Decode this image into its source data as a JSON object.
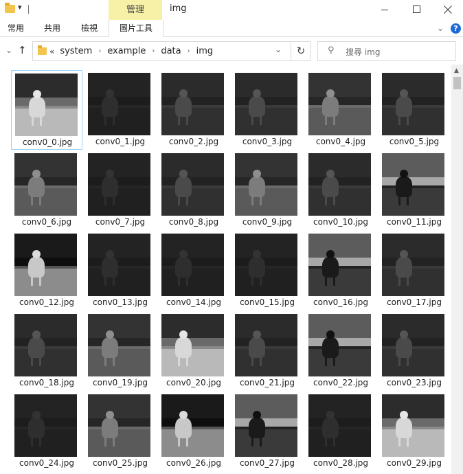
{
  "window": {
    "title": "img",
    "context_tab": "管理"
  },
  "ribbon": {
    "tabs": [
      "常用",
      "共用",
      "檢視",
      "圖片工具"
    ]
  },
  "address": {
    "overflow": "«",
    "crumbs": [
      "system",
      "example",
      "data",
      "img"
    ]
  },
  "search": {
    "placeholder": "搜尋 img"
  },
  "files": [
    {
      "name": "conv0_0.jpg",
      "tone": "bright"
    },
    {
      "name": "conv0_1.jpg",
      "tone": "dark"
    },
    {
      "name": "conv0_2.jpg",
      "tone": "dim"
    },
    {
      "name": "conv0_3.jpg",
      "tone": "dim"
    },
    {
      "name": "conv0_4.jpg",
      "tone": "mid"
    },
    {
      "name": "conv0_5.jpg",
      "tone": "dim"
    },
    {
      "name": "conv0_6.jpg",
      "tone": "mid"
    },
    {
      "name": "conv0_7.jpg",
      "tone": "dark"
    },
    {
      "name": "conv0_8.jpg",
      "tone": "dim"
    },
    {
      "name": "conv0_9.jpg",
      "tone": "mid"
    },
    {
      "name": "conv0_10.jpg",
      "tone": "dim"
    },
    {
      "name": "conv0_11.jpg",
      "tone": "inverted"
    },
    {
      "name": "conv0_12.jpg",
      "tone": "contrast"
    },
    {
      "name": "conv0_13.jpg",
      "tone": "dark"
    },
    {
      "name": "conv0_14.jpg",
      "tone": "dark"
    },
    {
      "name": "conv0_15.jpg",
      "tone": "dark"
    },
    {
      "name": "conv0_16.jpg",
      "tone": "inverted"
    },
    {
      "name": "conv0_17.jpg",
      "tone": "dim"
    },
    {
      "name": "conv0_18.jpg",
      "tone": "dim"
    },
    {
      "name": "conv0_19.jpg",
      "tone": "mid"
    },
    {
      "name": "conv0_20.jpg",
      "tone": "bright"
    },
    {
      "name": "conv0_21.jpg",
      "tone": "dim"
    },
    {
      "name": "conv0_22.jpg",
      "tone": "inverted"
    },
    {
      "name": "conv0_23.jpg",
      "tone": "dim"
    },
    {
      "name": "conv0_24.jpg",
      "tone": "dark"
    },
    {
      "name": "conv0_25.jpg",
      "tone": "mid"
    },
    {
      "name": "conv0_26.jpg",
      "tone": "contrast"
    },
    {
      "name": "conv0_27.jpg",
      "tone": "inverted"
    },
    {
      "name": "conv0_28.jpg",
      "tone": "dark"
    },
    {
      "name": "conv0_29.jpg",
      "tone": "bright"
    }
  ],
  "selected_file": "conv0_0.jpg",
  "colors": {
    "context_tab_bg": "#f7f1a8",
    "selection_border": "#99d1ff",
    "folder": "#f3c54e",
    "help": "#1e6ad8"
  }
}
